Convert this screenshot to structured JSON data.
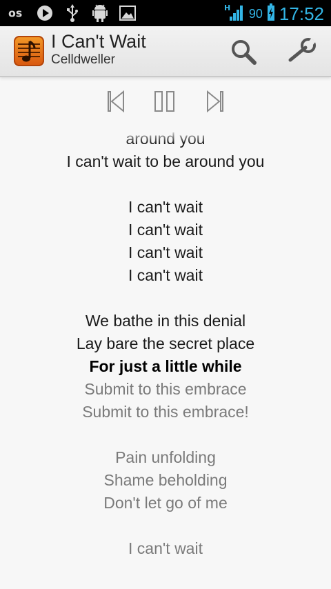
{
  "status_bar": {
    "icons": [
      "lastfm-icon",
      "play-icon",
      "usb-icon",
      "android-debug-icon",
      "gallery-icon"
    ],
    "network": "H",
    "battery": "90",
    "time": "17:52"
  },
  "action_bar": {
    "title": "I Can't Wait",
    "artist": "Celldweller"
  },
  "player": {
    "controls": [
      "previous-icon",
      "pause-icon",
      "next-icon"
    ]
  },
  "lyrics": {
    "lines": [
      {
        "text": "around you",
        "state": "past"
      },
      {
        "text": "I can't wait to be around you",
        "state": "past"
      },
      {
        "text": "",
        "state": "past"
      },
      {
        "text": "I can't wait",
        "state": "past"
      },
      {
        "text": "I can't wait",
        "state": "past"
      },
      {
        "text": "I can't wait",
        "state": "past"
      },
      {
        "text": "I can't wait",
        "state": "past"
      },
      {
        "text": "",
        "state": "past"
      },
      {
        "text": "We bathe in this denial",
        "state": "past"
      },
      {
        "text": "Lay bare the secret place",
        "state": "past"
      },
      {
        "text": "For just a little while",
        "state": "current"
      },
      {
        "text": "Submit to this embrace",
        "state": "future"
      },
      {
        "text": "Submit to this embrace!",
        "state": "future"
      },
      {
        "text": "",
        "state": "future"
      },
      {
        "text": "Pain unfolding",
        "state": "future"
      },
      {
        "text": "Shame beholding",
        "state": "future"
      },
      {
        "text": "Don't let go of me",
        "state": "future"
      },
      {
        "text": "",
        "state": "future"
      },
      {
        "text": "I can't wait",
        "state": "future"
      }
    ]
  },
  "colors": {
    "accent": "#33b5e5",
    "past_text": "#1a1a1a",
    "current_text": "#000000",
    "future_text": "#7a7a7a"
  }
}
